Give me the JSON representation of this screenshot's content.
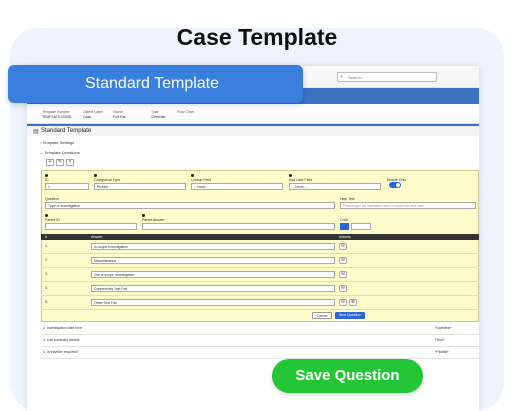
{
  "page_title": "Case Template",
  "banner_label": "Standard Template",
  "save_label": "Save Question",
  "search": {
    "placeholder": "Search..."
  },
  "record": {
    "fields": [
      {
        "label": "Template Number",
        "value": "TEMPLATE-00008"
      },
      {
        "label": "Object Label",
        "value": "Case"
      },
      {
        "label": "Owner",
        "value": "Full Kila"
      },
      {
        "label": "Type",
        "value": "Checklist"
      },
      {
        "label": "Flow Chart",
        "value": ""
      }
    ]
  },
  "template": {
    "header": "Standard Template",
    "sections": [
      "Template Settings",
      "Template Questions"
    ],
    "toolbar_icons": [
      "+",
      "✎",
      "×"
    ]
  },
  "question_form": {
    "id_label": "ID",
    "id_value": "1",
    "type_label": "Categorical Type",
    "type_value": "Picklist",
    "lookup_label": "Lookup Field",
    "lookup_value": "-- None --",
    "add_user_label": "Add User Field",
    "add_user_value": "-- None --",
    "enable_label": "Enable Only",
    "question_label": "Question",
    "question_value": "Type of Investigation",
    "help_label": "Help Text",
    "help_placeholder": "Please type an instruction text to assist the end user",
    "parent_id_label": "Parent ID",
    "parent_answer_label": "Parent Answer",
    "color_label": "Color"
  },
  "answers": {
    "headers": [
      "#",
      "Answer",
      "Actions"
    ],
    "rows": [
      {
        "num": "1.",
        "text": "In-scope Investigation"
      },
      {
        "num": "2.",
        "text": "Miscellaneous"
      },
      {
        "num": "3.",
        "text": "Out of scope Investigation"
      },
      {
        "num": "4.",
        "text": "Connectivity Test Fail"
      },
      {
        "num": "5.",
        "text": "Other Test Fail"
      }
    ]
  },
  "buttons": {
    "cancel": "Cancel",
    "next": "Next Question"
  },
  "questions_list": [
    {
      "q": "2. Investigation date time",
      "v": "*Datetime*"
    },
    {
      "q": "3. Call summary details",
      "v": "*Text*"
    },
    {
      "q": "4. Is traveller required?",
      "v": "*Picklist*"
    }
  ],
  "colors": {
    "accent": "#3a7ede",
    "save": "#22c637",
    "panel": "#fbfcc9"
  }
}
